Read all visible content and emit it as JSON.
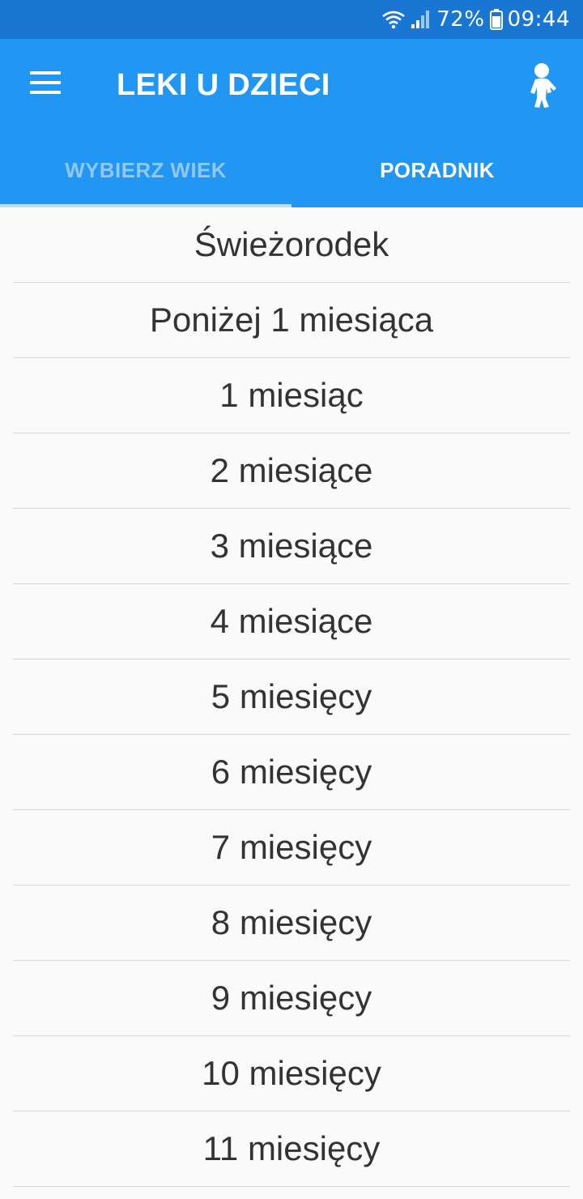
{
  "status_bar": {
    "battery_percent": "72%",
    "time": "09:44",
    "icons": [
      "wifi-icon",
      "signal-icon",
      "battery-icon"
    ]
  },
  "app_bar": {
    "title": "LEKI U DZIECI",
    "menu_icon": "hamburger-menu-icon",
    "action_icon": "child-figure-icon"
  },
  "tabs": [
    {
      "label": "WYBIERZ WIEK",
      "selected": true
    },
    {
      "label": "PORADNIK",
      "selected": false
    }
  ],
  "age_list": [
    "Świeżorodek",
    "Poniżej 1 miesiąca",
    "1 miesiąc",
    "2 miesiące",
    "3 miesiące",
    "4 miesiące",
    "5 miesięcy",
    "6 miesięcy",
    "7 miesięcy",
    "8 miesięcy",
    "9 miesięcy",
    "10 miesięcy",
    "11 miesięcy"
  ],
  "colors": {
    "status_bar": "#1976d2",
    "primary": "#2196f3",
    "tab_inactive_text": "#90c8f8",
    "tab_indicator": "#bbdefb",
    "list_text": "#333333",
    "divider": "#d6d6d6",
    "background": "#fafafa"
  }
}
